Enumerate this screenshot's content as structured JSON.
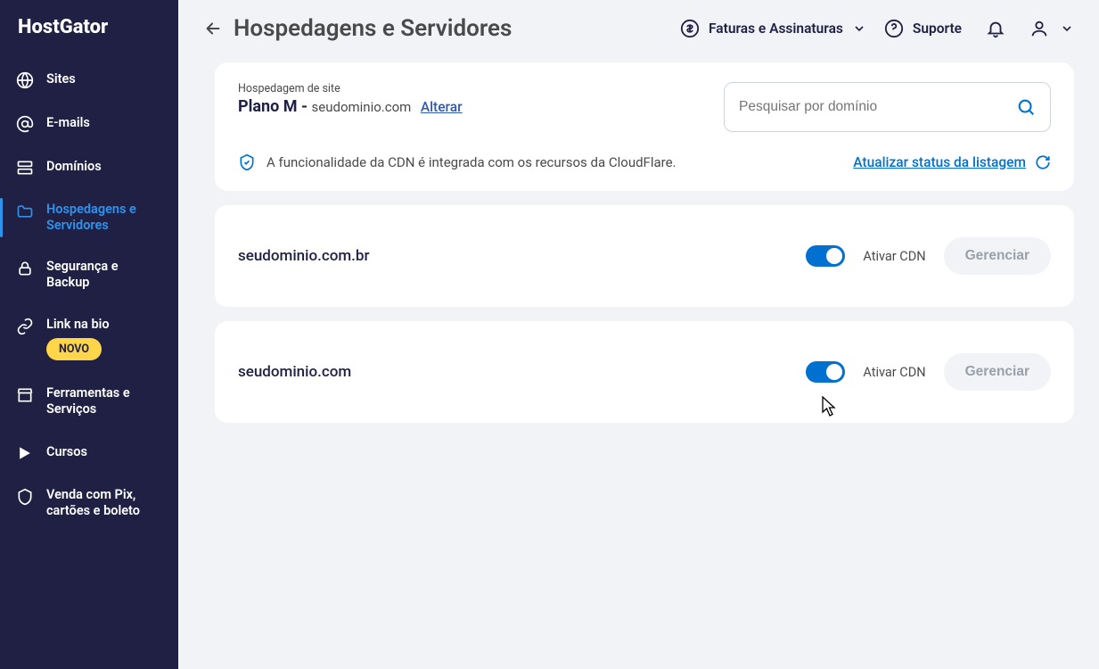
{
  "brand": {
    "logo_text": "HostGator"
  },
  "sidebar": {
    "items": [
      {
        "label": "Sites"
      },
      {
        "label": "E-mails"
      },
      {
        "label": "Domínios"
      },
      {
        "label": "Hospedagens e Servidores"
      },
      {
        "label": "Segurança e Backup"
      },
      {
        "label": "Link na bio",
        "badge": "NOVO"
      },
      {
        "label": "Ferramentas e Serviços"
      },
      {
        "label": "Cursos"
      },
      {
        "label": "Venda com Pix, cartões e boleto"
      }
    ]
  },
  "topbar": {
    "page_title": "Hospedagens e Servidores",
    "billing_label": "Faturas e Assinaturas",
    "support_label": "Suporte"
  },
  "header_card": {
    "overline": "Hospedagem de site",
    "plan_name": "Plano M",
    "separator": " - ",
    "plan_domain": "seudominio.com",
    "change_link": "Alterar",
    "search_placeholder": "Pesquisar por domínio",
    "info_text": "A funcionalidade da CDN é integrada com os recursos da CloudFlare.",
    "refresh_label": "Atualizar status da listagem"
  },
  "domain_rows": [
    {
      "domain": "seudominio.com.br",
      "toggle_label": "Ativar CDN",
      "manage_label": "Gerenciar"
    },
    {
      "domain": "seudominio.com",
      "toggle_label": "Ativar CDN",
      "manage_label": "Gerenciar"
    }
  ]
}
